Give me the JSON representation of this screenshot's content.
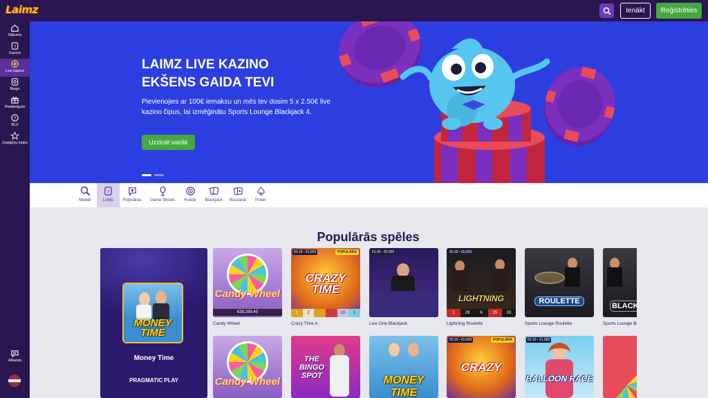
{
  "header": {
    "logo": "Laimz",
    "login_label": "Ienākt",
    "register_label": "Reģistrēties"
  },
  "sidebar": {
    "items": [
      {
        "label": "Sākums",
        "icon": "home-icon"
      },
      {
        "label": "Kazino",
        "icon": "slot-card-icon"
      },
      {
        "label": "Live kazino",
        "icon": "roulette-icon"
      },
      {
        "label": "Bingo",
        "icon": "bingo-ball-icon"
      },
      {
        "label": "Piedāvājumi",
        "icon": "gift-icon"
      },
      {
        "label": "BUJ",
        "icon": "question-icon"
      },
      {
        "label": "Zvaigžņu klubs",
        "icon": "star-icon"
      }
    ],
    "support_label": "Atbalsts",
    "language_flag": "latvia-flag"
  },
  "hero": {
    "title_line1": "LAIMZ LIVE KAZINO",
    "title_line2": "EKŠENS GAIDA TEVI",
    "text": "Pievienojies ar 100€ iemaksu un mēs tev dosim 5 x 2.50€ live kazino čipus, lai izmēģinātu Sports Lounge Blackjack 4.",
    "button_label": "Uzzināt vairāk",
    "active_slide": 1,
    "slides_count": 2
  },
  "categories": [
    {
      "label": "Meklēt",
      "icon": "search-icon"
    },
    {
      "label": "Lobijs",
      "icon": "lobby-icon"
    },
    {
      "label": "Populāras",
      "icon": "popular-icon"
    },
    {
      "label": "Game Shows",
      "icon": "microphone-icon"
    },
    {
      "label": "Rulete",
      "icon": "roulette-icon"
    },
    {
      "label": "Blackjack",
      "icon": "cards-icon"
    },
    {
      "label": "Baccarat",
      "icon": "baccarat-icon"
    },
    {
      "label": "Poker",
      "icon": "spade-icon"
    }
  ],
  "popular": {
    "title": "Populārās spēles",
    "featured": {
      "name": "Money Time",
      "provider": "PRAGMATIC PLAY",
      "logo_text": "MONEY TIME"
    },
    "row1": [
      {
        "name": "Candy Wheel",
        "amount": "€39,299.45",
        "bet": "",
        "popular": "",
        "brand": "Candy Wheel"
      },
      {
        "name": "Crazy Time A",
        "amount": "",
        "bet": "€0.10 - €2,500",
        "popular": "POPULĀRA",
        "brand": "CRAZY TIME"
      },
      {
        "name": "Live One Blackjack",
        "amount": "",
        "bet": "€1.00 - €5,000",
        "popular": "",
        "brand": ""
      },
      {
        "name": "Lightning Roulette",
        "amount": "",
        "bet": "€0.20 - €5,000",
        "popular": "",
        "brand": "LIGHTNING"
      },
      {
        "name": "Sports Lounge Roulette",
        "amount": "",
        "bet": "",
        "popular": "",
        "brand": "ROULETTE"
      },
      {
        "name": "Sports Lounge Bl",
        "amount": "",
        "bet": "",
        "popular": "",
        "brand": "BLACK"
      }
    ],
    "crazy_results": [
      "1",
      "2",
      "",
      "",
      "10",
      "1"
    ],
    "lightning_results": [
      "1",
      "29",
      "6",
      "25",
      "33"
    ],
    "row2": [
      {
        "brand": "Candy Wheel",
        "bet": "",
        "popular": ""
      },
      {
        "brand": "THE BINGO SPOT",
        "bet": "",
        "popular": ""
      },
      {
        "brand": "MONEY TIME",
        "bet": "",
        "popular": ""
      },
      {
        "brand": "CRAZY",
        "bet": "€0.10 - €2,500",
        "popular": "POPULĀRA"
      },
      {
        "brand": "BALLOON RACE",
        "bet": "€0.10 - €1,500",
        "popular": ""
      },
      {
        "brand": "",
        "bet": "",
        "popular": ""
      }
    ]
  },
  "colors": {
    "brand_dark": "#2a1650",
    "accent_purple": "#5a2f9e",
    "green": "#45a83e",
    "hero_blue": "#2d3ee0"
  }
}
